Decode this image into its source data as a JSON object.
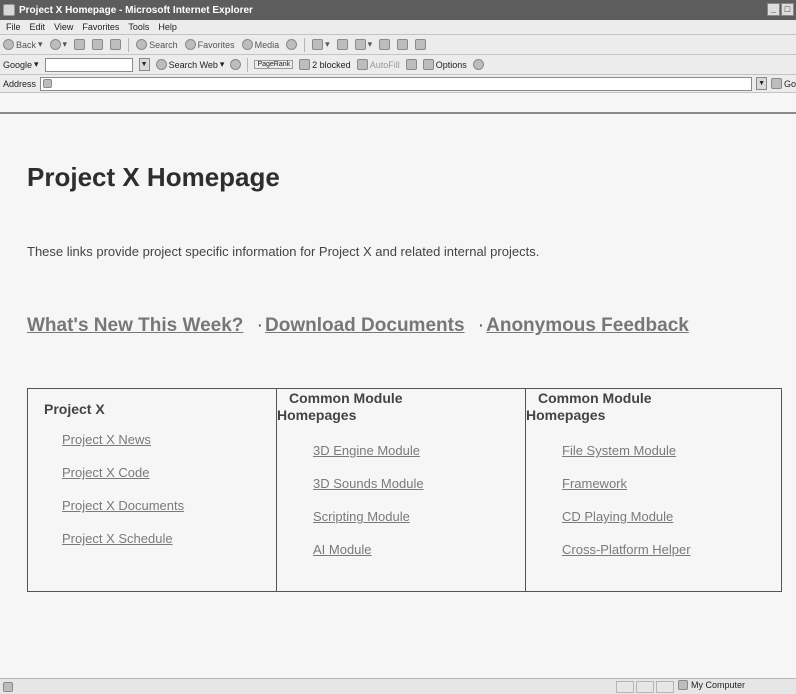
{
  "window": {
    "title": "Project X Homepage - Microsoft Internet Explorer"
  },
  "menu": [
    "File",
    "Edit",
    "View",
    "Favorites",
    "Tools",
    "Help"
  ],
  "toolbar": {
    "back": "Back",
    "search": "Search",
    "favorites": "Favorites",
    "media": "Media"
  },
  "googlebar": {
    "logo": "Google",
    "search_web": "Search Web",
    "pagerank": "PageRank",
    "blocked": "2 blocked",
    "autofill": "AutoFill",
    "options": "Options"
  },
  "address": {
    "label": "Address",
    "value": "",
    "go": "Go"
  },
  "page": {
    "title": "Project X Homepage",
    "intro": "These links provide project specific information for Project X and related internal projects.",
    "nav": [
      {
        "label": "What's New This Week?"
      },
      {
        "label": "Download Documents"
      },
      {
        "label": "Anonymous Feedback"
      }
    ],
    "separator": "·",
    "columns": [
      {
        "heading": "Project X",
        "links": [
          "Project X News",
          "Project X Code",
          "Project X Documents",
          "Project X Schedule"
        ]
      },
      {
        "heading_line1": "Common Module",
        "heading_line2": "Homepages",
        "links": [
          "3D Engine Module",
          "3D Sounds Module",
          "Scripting Module",
          "AI Module"
        ]
      },
      {
        "heading_line1": "Common Module",
        "heading_line2": "Homepages",
        "links": [
          "File System Module",
          "Framework",
          "CD Playing Module",
          "Cross-Platform Helper"
        ]
      }
    ]
  },
  "status": {
    "zone": "My Computer"
  }
}
